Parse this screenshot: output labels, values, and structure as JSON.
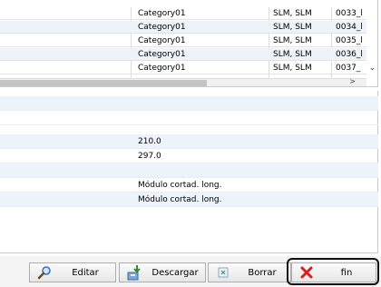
{
  "grid": {
    "rows": [
      {
        "category": "Category01",
        "type": "SLM, SLM",
        "code": "0033_l"
      },
      {
        "category": "Category01",
        "type": "SLM, SLM",
        "code": "0034_l"
      },
      {
        "category": "Category01",
        "type": "SLM, SLM",
        "code": "0035_l"
      },
      {
        "category": "Category01",
        "type": "SLM, SLM",
        "code": "0036_l"
      },
      {
        "category": "Category01",
        "type": "SLM, SLM",
        "code": "0037_"
      }
    ],
    "scroll_right_glyph": ">",
    "scroll_down_glyph": "⌄"
  },
  "detail": {
    "rows": [
      "",
      "",
      "210.0",
      "297.0",
      "",
      "Módulo cortad. long.",
      "Módulo cortad. long."
    ]
  },
  "toolbar": {
    "edit_label": "Editar",
    "download_label": "Descargar",
    "delete_label": "Borrar",
    "end_label": "fin"
  },
  "colors": {
    "row_alt": "#edf3fb",
    "close_red": "#d62020"
  }
}
